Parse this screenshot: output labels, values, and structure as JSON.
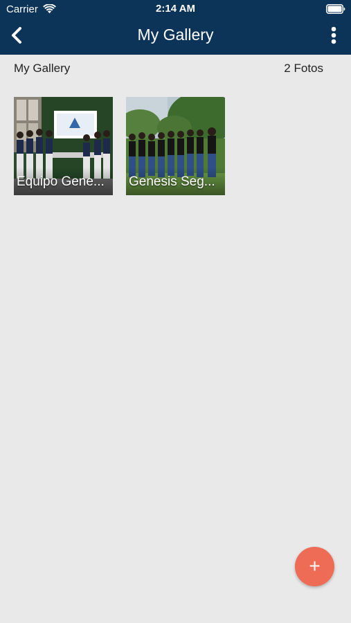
{
  "status_bar": {
    "carrier": "Carrier",
    "time": "2:14 AM"
  },
  "nav": {
    "title": "My Gallery",
    "back_icon": "chevron-left-icon",
    "more_icon": "more-vertical-icon"
  },
  "gallery": {
    "name": "My Gallery",
    "count": "2 Fotos",
    "albums": [
      {
        "label": "Equipo Gene..."
      },
      {
        "label": "Genesis Seg..."
      }
    ]
  },
  "fab": {
    "label": "+",
    "icon": "plus-icon",
    "color": "#ee6b55"
  },
  "colors": {
    "header": "#0c3358",
    "background": "#e9e9e9"
  }
}
